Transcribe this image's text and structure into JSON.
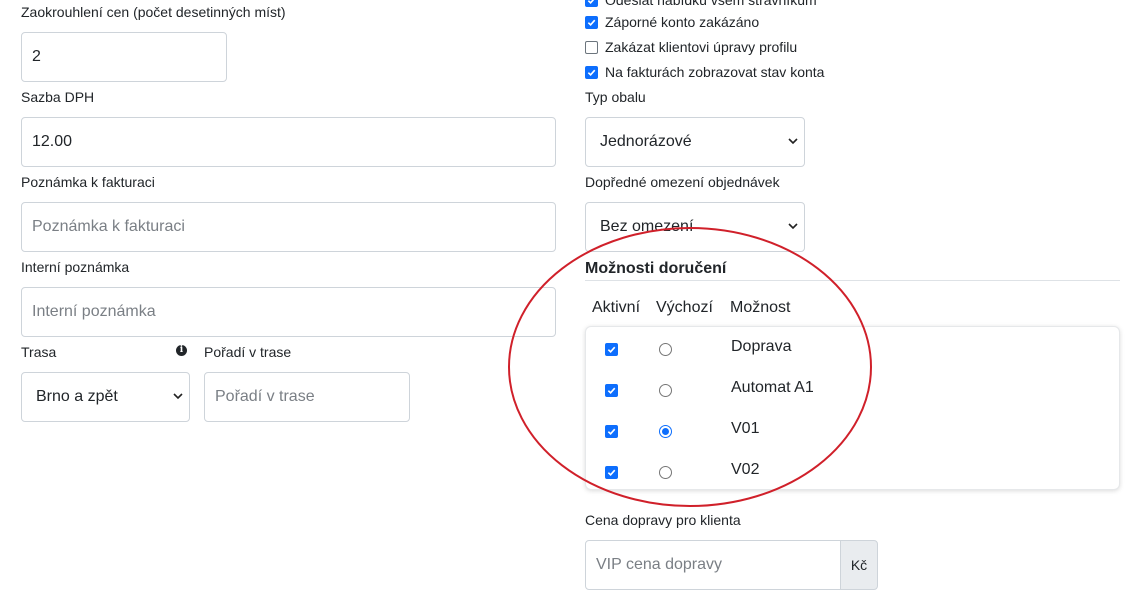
{
  "left": {
    "rounding_label": "Zaokrouhlení cen (počet desetinných míst)",
    "rounding_value": "2",
    "vat_label": "Sazba DPH",
    "vat_value": "12.00",
    "invoice_note_label": "Poznámka k fakturaci",
    "invoice_note_placeholder": "Poznámka k fakturaci",
    "internal_note_label": "Interní poznámka",
    "internal_note_placeholder": "Interní poznámka",
    "route_label": "Trasa",
    "route_info_icon": "info-icon",
    "route_value": "Brno a zpět",
    "route_order_label": "Pořadí v trase",
    "route_order_placeholder": "Pořadí v trase"
  },
  "right": {
    "checkboxes": [
      {
        "label": "Odeslat nabídku všem strávníkům",
        "checked": true
      },
      {
        "label": "Záporné konto zakázáno",
        "checked": true
      },
      {
        "label": "Zakázat klientovi úpravy profilu",
        "checked": false
      },
      {
        "label": "Na fakturách zobrazovat stav konta",
        "checked": true
      }
    ],
    "package_label": "Typ obalu",
    "package_value": "Jednorázové",
    "order_limit_label": "Dopředné omezení objednávek",
    "order_limit_value": "Bez omezení",
    "delivery": {
      "title": "Možnosti doručení",
      "col_active": "Aktivní",
      "col_default": "Výchozí",
      "col_option": "Možnost",
      "rows": [
        {
          "name": "Doprava",
          "active": true,
          "default": false
        },
        {
          "name": "Automat A1",
          "active": true,
          "default": false
        },
        {
          "name": "V01",
          "active": true,
          "default": true
        },
        {
          "name": "V02",
          "active": true,
          "default": false
        }
      ]
    },
    "shipping_price_label": "Cena dopravy pro klienta",
    "shipping_price_placeholder": "VIP cena dopravy",
    "currency": "Kč"
  },
  "colors": {
    "accent": "#0d6efd",
    "annotation_ellipse": "#d0202a"
  }
}
